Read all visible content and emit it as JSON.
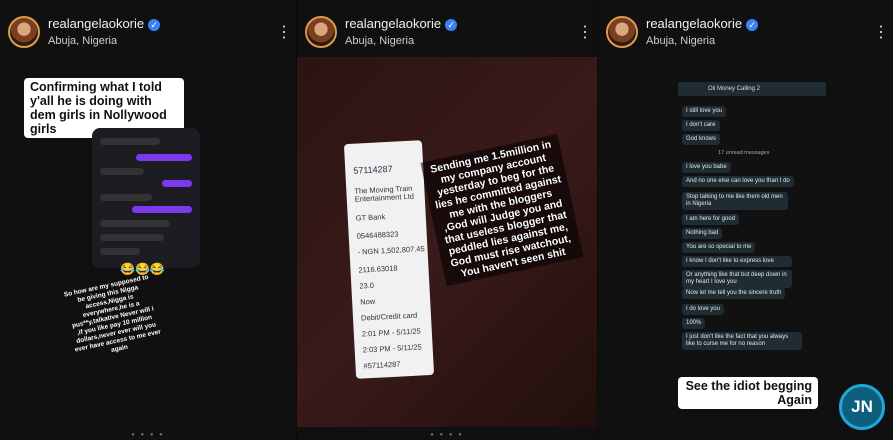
{
  "posts": [
    {
      "username": "realangelaokorie",
      "location": "Abuja, Nigeria",
      "caption": "Confirming what I told y'all he is doing with dem girls in Nollywood girls",
      "lower_text": "So how are my supposed to be giving this Nigga access,Nigga is everywhere,he is a pus**y,talkative Never will i ,if you like pay 10 million dollars,never ever will you ever have access to me ever again"
    },
    {
      "username": "realangelaokorie",
      "location": "Abuja, Nigeria",
      "receipt_lines": [
        "57114287",
        "The Moving Train Entertainment Ltd",
        "GT Bank",
        "0546488323",
        "- NGN 1,502,807.45",
        "2116.63018",
        "23.0",
        "Now",
        "Debit/Credit card",
        "2:01 PM - 5/11/25",
        "2:03 PM - 5/11/25",
        "#57114287"
      ],
      "overlay": "Sending me 1.5million in my company account yesterday to beg for the lies he committed against me with the bloggers ,God will Judge you and that useless blogger that peddled lies against me, God must rise watchout, You haven't seen shit"
    },
    {
      "username": "realangelaokorie",
      "location": "Abuja, Nigeria",
      "chat_title": "Oil Money Calling 2",
      "messages": [
        "I still love you",
        "I don't care",
        "God knows",
        "17 unread messages",
        "I love you babe",
        "And no one else can love you than I do",
        "Stop talking to me like them old men in Nigeria",
        "I am here for good",
        "Nothing bad",
        "You are so special to me",
        "I know I don't like to express love",
        "Or anything like that but deep down in my heart I love you",
        "Now let me tell you the sincere truth",
        "I do love you",
        "100%",
        "I just don't like the fact that you always like to curse me for no reason"
      ],
      "caption": "See the idiot begging Again"
    }
  ],
  "watermark": "JN"
}
